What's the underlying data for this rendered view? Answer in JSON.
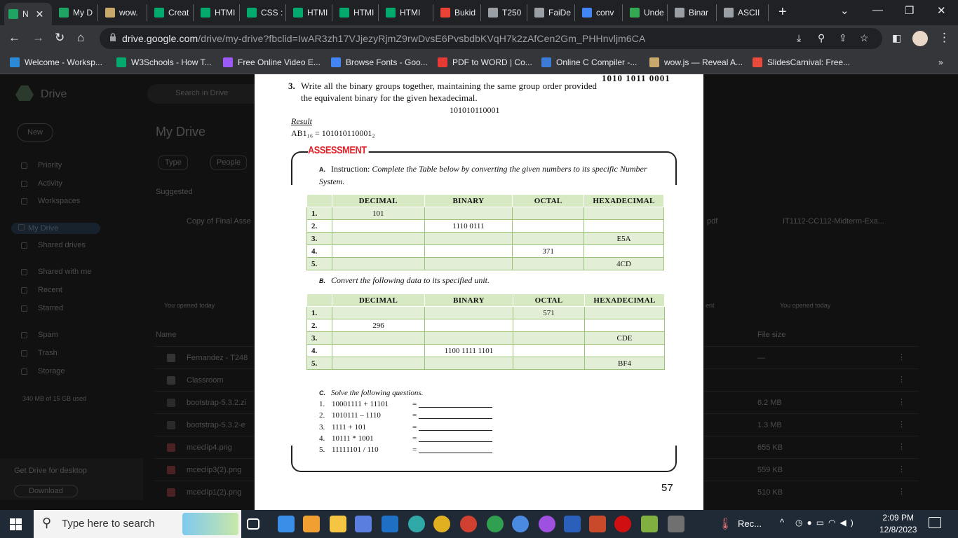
{
  "browser": {
    "tabs": [
      {
        "label": "N",
        "icon": "drive-icon",
        "color": "#1fa463",
        "active": true
      },
      {
        "label": "My D",
        "icon": "drive-icon",
        "color": "#1fa463"
      },
      {
        "label": "wow.",
        "icon": "wow-icon",
        "color": "#c8a96b"
      },
      {
        "label": "Creat",
        "icon": "w3schools-icon",
        "color": "#04aa6d"
      },
      {
        "label": "HTMI",
        "icon": "w3schools-icon",
        "color": "#04aa6d"
      },
      {
        "label": "CSS :",
        "icon": "w3schools-icon",
        "color": "#04aa6d"
      },
      {
        "label": "HTMI",
        "icon": "w3schools-icon",
        "color": "#04aa6d"
      },
      {
        "label": "HTMI",
        "icon": "w3schools-icon",
        "color": "#04aa6d"
      },
      {
        "label": "HTMI",
        "icon": "w3schools-icon",
        "color": "#04aa6d"
      },
      {
        "label": "Bukid",
        "icon": "gmail-icon",
        "color": "#ea4335"
      },
      {
        "label": "T250",
        "icon": "tab-icon",
        "color": "#9aa0a6"
      },
      {
        "label": "FaiDe",
        "icon": "globe-icon",
        "color": "#9aa0a6"
      },
      {
        "label": "conv",
        "icon": "search-icon",
        "color": "#4285f4"
      },
      {
        "label": "Unde",
        "icon": "link-icon",
        "color": "#34a853"
      },
      {
        "label": "Binar",
        "icon": "globe-icon",
        "color": "#9aa0a6"
      },
      {
        "label": "ASCII",
        "icon": "globe-icon",
        "color": "#9aa0a6"
      }
    ],
    "url_host": "drive.google.com",
    "url_path": "/drive/my-drive?fbclid=IwAR3zh17VJjezyRjmZ9rwDvsE6PvsbdbKVqH7k2zAfCen2Gm_PHHnvljm6CA",
    "bookmarks": [
      {
        "label": "Welcome - Worksp...",
        "icon": "vscode-icon",
        "color": "#2b8ad8"
      },
      {
        "label": "W3Schools - How T...",
        "icon": "w3schools-icon",
        "color": "#04aa6d"
      },
      {
        "label": "Free Online Video E...",
        "icon": "video-icon",
        "color": "#9b59f6"
      },
      {
        "label": "Browse Fonts - Goo...",
        "icon": "fonts-icon",
        "color": "#4285f4"
      },
      {
        "label": "PDF to WORD | Co...",
        "icon": "pdf-icon",
        "color": "#e53935"
      },
      {
        "label": "Online C Compiler -...",
        "icon": "bolt-icon",
        "color": "#3d7bd8"
      },
      {
        "label": "wow.js — Reveal A...",
        "icon": "wow-icon",
        "color": "#c8a96b"
      },
      {
        "label": "SlidesCarnival: Free...",
        "icon": "slides-icon",
        "color": "#e84a3b"
      }
    ],
    "more_bookmarks": "»"
  },
  "drive": {
    "app_name": "Drive",
    "search_placeholder": "Search in Drive",
    "new_button": "New",
    "nav": [
      "Priority",
      "Activity",
      "Workspaces",
      "My Drive",
      "Shared drives",
      "Shared with me",
      "Recent",
      "Starred",
      "Spam",
      "Trash",
      "Storage"
    ],
    "storage": "340 MB of 15 GB used",
    "title": "My Drive",
    "filters": [
      "Type",
      "People"
    ],
    "suggested": "Suggested",
    "cards": [
      "Copy of Final Asse",
      "pdf",
      "IT1112-CC112-Midterm-Exa..."
    ],
    "opened": [
      "You opened today",
      "ent",
      "You opened today"
    ],
    "col_name": "Name",
    "col_size": "File size",
    "files": [
      {
        "name": "Fernandez - T248",
        "size": "—"
      },
      {
        "name": "Classroom",
        "size": ""
      },
      {
        "name": "bootstrap-5.3.2.zi",
        "size": "6.2 MB"
      },
      {
        "name": "bootstrap-5.3.2-e",
        "size": "1.3 MB"
      },
      {
        "name": "mceclip4.png",
        "size": "655 KB"
      },
      {
        "name": "mceclip3(2).png",
        "size": "559 KB"
      },
      {
        "name": "mceclip1(2).png",
        "size": "510 KB"
      }
    ],
    "promo": "Get Drive for desktop",
    "promo_button": "Download"
  },
  "document": {
    "corner_binary": "1010   1011   0001",
    "step3_num": "3.",
    "step3_text": "Write all the binary groups together, maintaining the same group order provided the equivalent binary for the given hexadecimal.",
    "step3_value": "101010110001",
    "result_label": "Result",
    "result_value": "AB1₁₆ = 101010110001₂",
    "assessment_title": "ASSESSMENT",
    "section_a_label": "A.",
    "section_a_lead": "Instruction:",
    "section_a_text": "Complete the Table below by converting the given numbers to its specific Number System.",
    "table_headers": [
      "",
      "DECIMAL",
      "BINARY",
      "OCTAL",
      "HEXADECIMAL"
    ],
    "table_a_rows": [
      [
        "1.",
        "101",
        "",
        "",
        ""
      ],
      [
        "2.",
        "",
        "1110 0111",
        "",
        ""
      ],
      [
        "3.",
        "",
        "",
        "",
        "E5A"
      ],
      [
        "4.",
        "",
        "",
        "371",
        ""
      ],
      [
        "5.",
        "",
        "",
        "",
        "4CD"
      ]
    ],
    "section_b_label": "B.",
    "section_b_text": "Convert the following data to its specified unit.",
    "table_b_rows": [
      [
        "1.",
        "",
        "",
        "571",
        ""
      ],
      [
        "2.",
        "296",
        "",
        "",
        ""
      ],
      [
        "3.",
        "",
        "",
        "",
        "CDE"
      ],
      [
        "4.",
        "",
        "1100 1111 1101",
        "",
        ""
      ],
      [
        "5.",
        "",
        "",
        "",
        "BF4"
      ]
    ],
    "section_c_label": "C.",
    "section_c_text": "Solve the following questions.",
    "questions": [
      {
        "num": "1.",
        "expr": "10001111 + 11101"
      },
      {
        "num": "2.",
        "expr": "1010111 – 1110"
      },
      {
        "num": "3.",
        "expr": "1111 + 101"
      },
      {
        "num": "4.",
        "expr": "10111 * 1001"
      },
      {
        "num": "5.",
        "expr": "11111101 / 110"
      }
    ],
    "equals": "=",
    "page_number": "57"
  },
  "taskbar": {
    "search_placeholder": "Type here to search",
    "recorder_label": "Rec...",
    "time": "2:09 PM",
    "date": "12/8/2023"
  }
}
